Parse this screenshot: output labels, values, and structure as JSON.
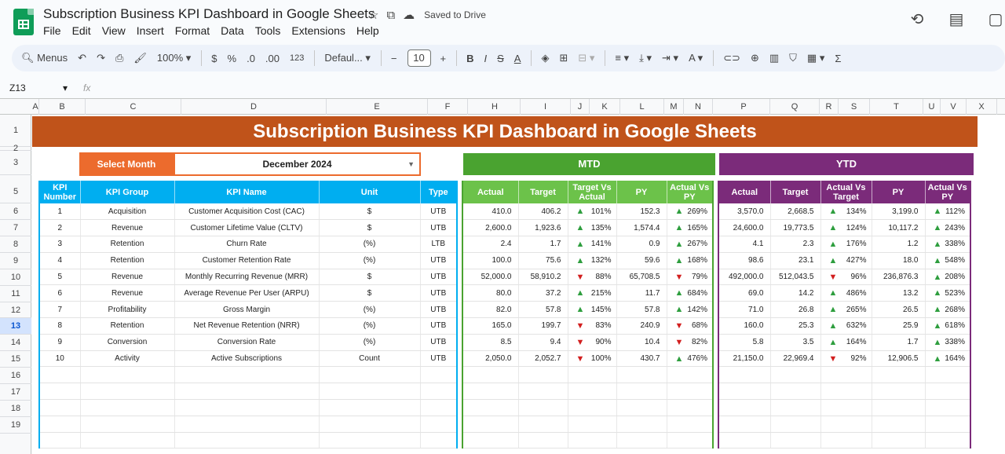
{
  "app": {
    "doc_title": "Subscription Business KPI Dashboard in Google Sheets",
    "saved_status": "Saved to Drive",
    "menu": [
      "File",
      "Edit",
      "View",
      "Insert",
      "Format",
      "Data",
      "Tools",
      "Extensions",
      "Help"
    ]
  },
  "toolbar": {
    "menus_label": "Menus",
    "zoom": "100%",
    "currency": "$",
    "percent": "%",
    "dec_decrease": ".0",
    "dec_increase": ".00",
    "number_format": "123",
    "font": "Defaul...",
    "font_size": "10"
  },
  "formula_bar": {
    "cell_ref": "Z13",
    "fx": "fx"
  },
  "columns": [
    "A",
    "B",
    "C",
    "D",
    "E",
    "F",
    "H",
    "I",
    "J",
    "K",
    "L",
    "M",
    "N",
    "P",
    "Q",
    "R",
    "S",
    "T",
    "U",
    "V",
    "X"
  ],
  "rows": [
    "1",
    "2",
    "3",
    "4",
    "5",
    "6",
    "7",
    "8",
    "9",
    "10",
    "11",
    "12",
    "13",
    "14",
    "15",
    "16",
    "17",
    "18",
    "19"
  ],
  "dashboard": {
    "title": "Subscription Business KPI Dashboard in Google Sheets",
    "select_month_label": "Select Month",
    "selected_month": "December 2024",
    "mtd_label": "MTD",
    "ytd_label": "YTD",
    "left_headers": [
      "KPI Number",
      "KPI Group",
      "KPI Name",
      "Unit",
      "Type"
    ],
    "mtd_headers": [
      "Actual",
      "Target",
      "Target Vs Actual",
      "PY",
      "Actual Vs PY"
    ],
    "ytd_headers": [
      "Actual",
      "Target",
      "Actual Vs Target",
      "PY",
      "Actual Vs PY"
    ],
    "kpis": [
      {
        "num": "1",
        "group": "Acquisition",
        "name": "Customer Acquisition Cost (CAC)",
        "unit": "$",
        "type": "UTB",
        "mtd": {
          "actual": "410.0",
          "target": "406.2",
          "tva_dir": "up",
          "tva": "101%",
          "py": "152.3",
          "avp_dir": "up",
          "avp": "269%"
        },
        "ytd": {
          "actual": "3,570.0",
          "target": "2,668.5",
          "avt_dir": "up",
          "avt": "134%",
          "py": "3,199.0",
          "avp_dir": "up",
          "avp": "112%"
        }
      },
      {
        "num": "2",
        "group": "Revenue",
        "name": "Customer Lifetime Value (CLTV)",
        "unit": "$",
        "type": "UTB",
        "mtd": {
          "actual": "2,600.0",
          "target": "1,923.6",
          "tva_dir": "up",
          "tva": "135%",
          "py": "1,574.4",
          "avp_dir": "up",
          "avp": "165%"
        },
        "ytd": {
          "actual": "24,600.0",
          "target": "19,773.5",
          "avt_dir": "up",
          "avt": "124%",
          "py": "10,117.2",
          "avp_dir": "up",
          "avp": "243%"
        }
      },
      {
        "num": "3",
        "group": "Retention",
        "name": "Churn Rate",
        "unit": "(%)",
        "type": "LTB",
        "mtd": {
          "actual": "2.4",
          "target": "1.7",
          "tva_dir": "up",
          "tva": "141%",
          "py": "0.9",
          "avp_dir": "up",
          "avp": "267%"
        },
        "ytd": {
          "actual": "4.1",
          "target": "2.3",
          "avt_dir": "up",
          "avt": "176%",
          "py": "1.2",
          "avp_dir": "up",
          "avp": "338%"
        }
      },
      {
        "num": "4",
        "group": "Retention",
        "name": "Customer Retention Rate",
        "unit": "(%)",
        "type": "UTB",
        "mtd": {
          "actual": "100.0",
          "target": "75.6",
          "tva_dir": "up",
          "tva": "132%",
          "py": "59.6",
          "avp_dir": "up",
          "avp": "168%"
        },
        "ytd": {
          "actual": "98.6",
          "target": "23.1",
          "avt_dir": "up",
          "avt": "427%",
          "py": "18.0",
          "avp_dir": "up",
          "avp": "548%"
        }
      },
      {
        "num": "5",
        "group": "Revenue",
        "name": "Monthly Recurring Revenue (MRR)",
        "unit": "$",
        "type": "UTB",
        "mtd": {
          "actual": "52,000.0",
          "target": "58,910.2",
          "tva_dir": "down",
          "tva": "88%",
          "py": "65,708.5",
          "avp_dir": "down",
          "avp": "79%"
        },
        "ytd": {
          "actual": "492,000.0",
          "target": "512,043.5",
          "avt_dir": "down",
          "avt": "96%",
          "py": "236,876.3",
          "avp_dir": "up",
          "avp": "208%"
        }
      },
      {
        "num": "6",
        "group": "Revenue",
        "name": "Average Revenue Per User (ARPU)",
        "unit": "$",
        "type": "UTB",
        "mtd": {
          "actual": "80.0",
          "target": "37.2",
          "tva_dir": "up",
          "tva": "215%",
          "py": "11.7",
          "avp_dir": "up",
          "avp": "684%"
        },
        "ytd": {
          "actual": "69.0",
          "target": "14.2",
          "avt_dir": "up",
          "avt": "486%",
          "py": "13.2",
          "avp_dir": "up",
          "avp": "523%"
        }
      },
      {
        "num": "7",
        "group": "Profitability",
        "name": "Gross Margin",
        "unit": "(%)",
        "type": "UTB",
        "mtd": {
          "actual": "82.0",
          "target": "57.8",
          "tva_dir": "up",
          "tva": "145%",
          "py": "57.8",
          "avp_dir": "up",
          "avp": "142%"
        },
        "ytd": {
          "actual": "71.0",
          "target": "26.8",
          "avt_dir": "up",
          "avt": "265%",
          "py": "26.5",
          "avp_dir": "up",
          "avp": "268%"
        }
      },
      {
        "num": "8",
        "group": "Retention",
        "name": "Net Revenue Retention (NRR)",
        "unit": "(%)",
        "type": "UTB",
        "mtd": {
          "actual": "165.0",
          "target": "199.7",
          "tva_dir": "down",
          "tva": "83%",
          "py": "240.9",
          "avp_dir": "down",
          "avp": "68%"
        },
        "ytd": {
          "actual": "160.0",
          "target": "25.3",
          "avt_dir": "up",
          "avt": "632%",
          "py": "25.9",
          "avp_dir": "up",
          "avp": "618%"
        }
      },
      {
        "num": "9",
        "group": "Conversion",
        "name": "Conversion Rate",
        "unit": "(%)",
        "type": "UTB",
        "mtd": {
          "actual": "8.5",
          "target": "9.4",
          "tva_dir": "down",
          "tva": "90%",
          "py": "10.4",
          "avp_dir": "down",
          "avp": "82%"
        },
        "ytd": {
          "actual": "5.8",
          "target": "3.5",
          "avt_dir": "up",
          "avt": "164%",
          "py": "1.7",
          "avp_dir": "up",
          "avp": "338%"
        }
      },
      {
        "num": "10",
        "group": "Activity",
        "name": "Active Subscriptions",
        "unit": "Count",
        "type": "UTB",
        "mtd": {
          "actual": "2,050.0",
          "target": "2,052.7",
          "tva_dir": "down",
          "tva": "100%",
          "py": "430.7",
          "avp_dir": "up",
          "avp": "476%"
        },
        "ytd": {
          "actual": "21,150.0",
          "target": "22,969.4",
          "avt_dir": "down",
          "avt": "92%",
          "py": "12,906.5",
          "avp_dir": "up",
          "avp": "164%"
        }
      }
    ],
    "empty_rows": 5
  },
  "colors": {
    "banner": "#c0531a",
    "select": "#ec6b2d",
    "mtd": "#4aa330",
    "ytd": "#7b2b7a",
    "kpi_header": "#00aef0",
    "up": "#2e9e3e",
    "down": "#d21f1f"
  }
}
